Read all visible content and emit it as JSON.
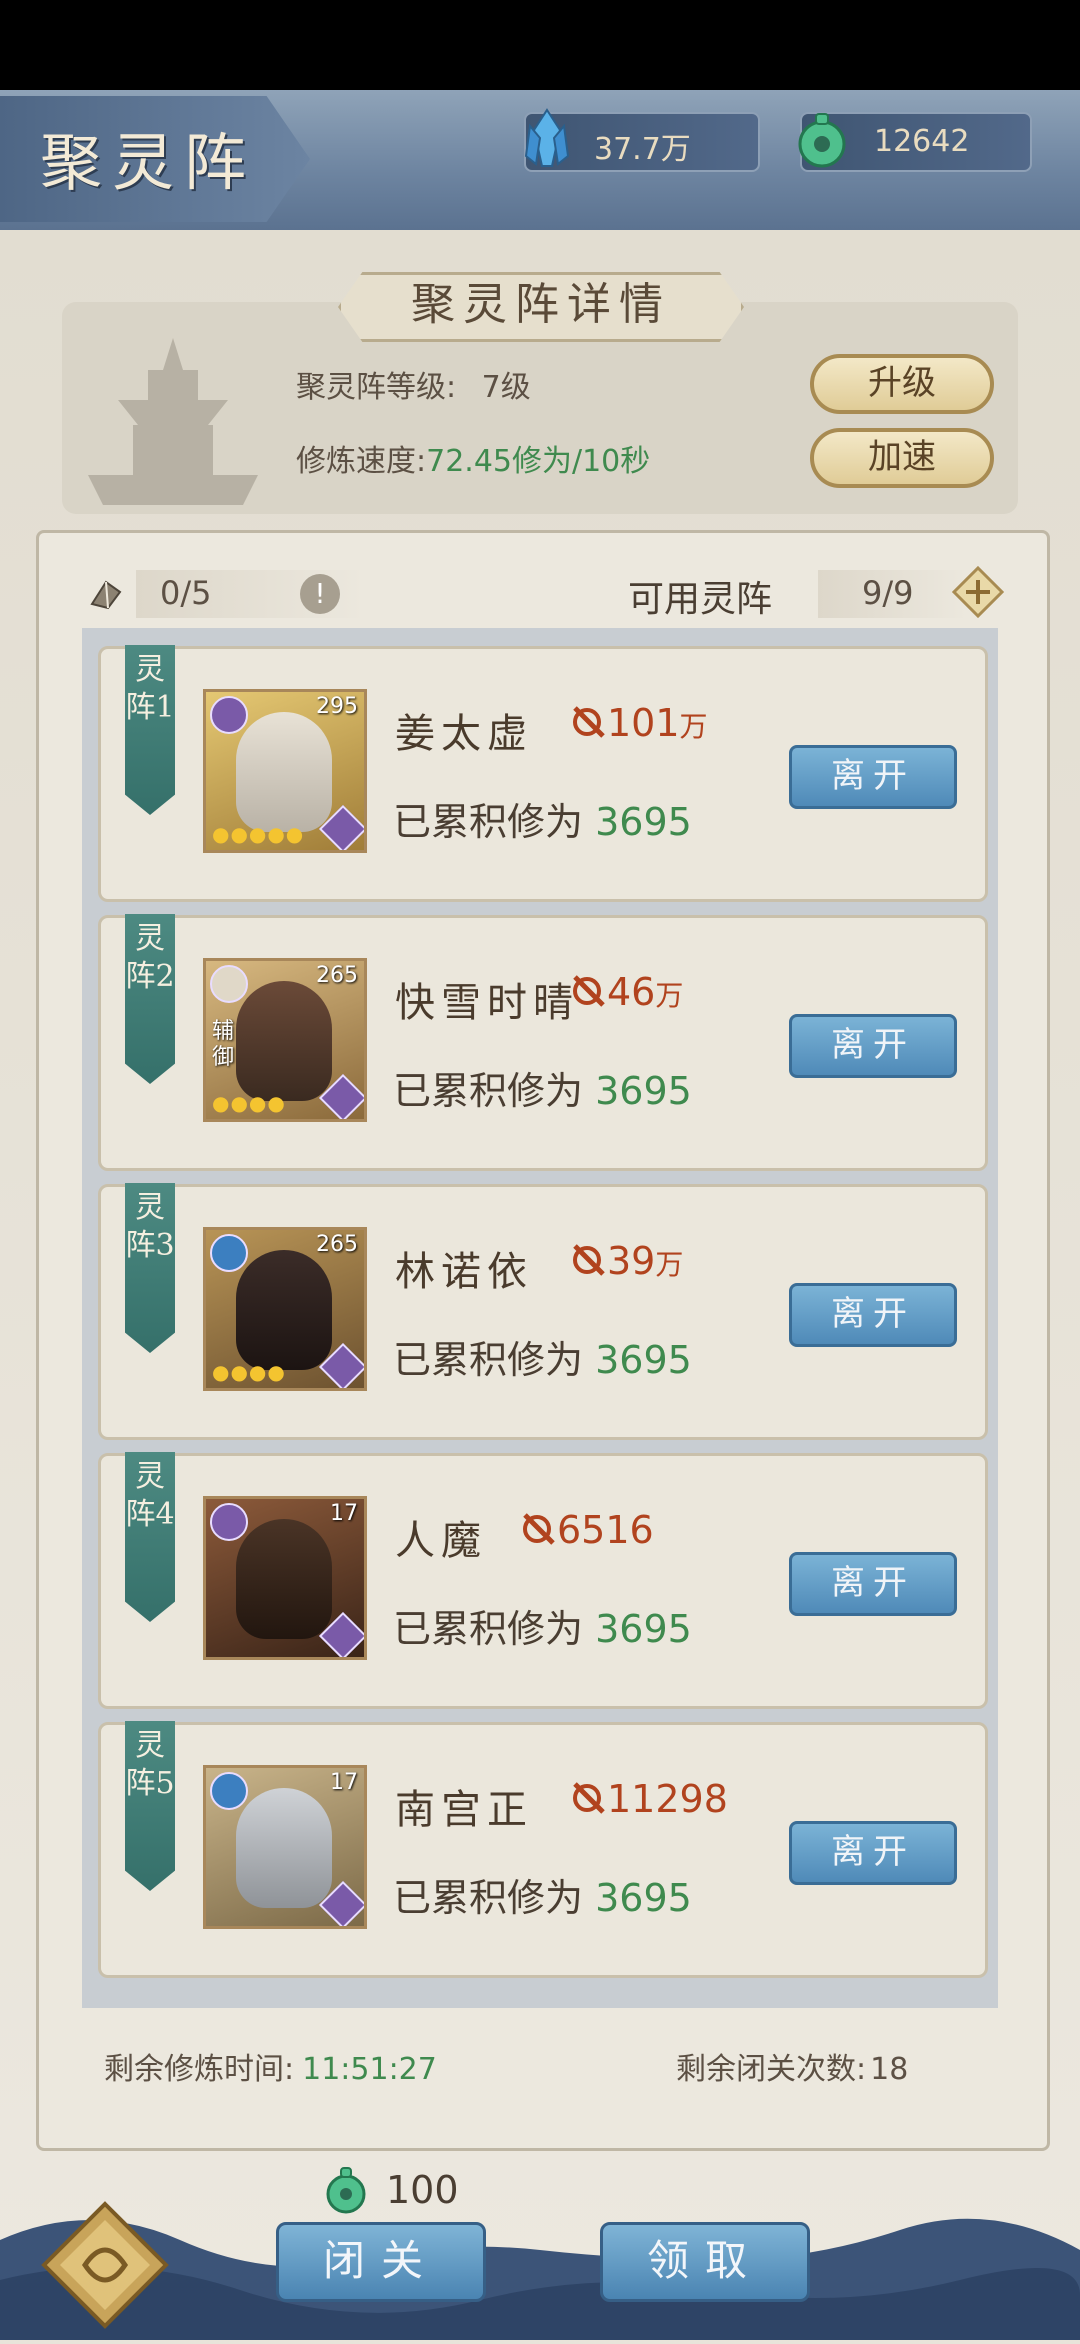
{
  "header": {
    "title": "聚灵阵",
    "spirit_stones": "37.7万",
    "jade": "12642"
  },
  "detail": {
    "section_title": "聚灵阵详情",
    "level_label": "聚灵阵等级:",
    "level_value": "7级",
    "speed_label": "修炼速度:",
    "speed_value": "72.45修为/10秒",
    "upgrade_label": "升级",
    "speedup_label": "加速"
  },
  "array_bar": {
    "occupied": "0/5",
    "available_label": "可用灵阵",
    "available_value": "9/9"
  },
  "slots": [
    {
      "tag": "灵阵1",
      "level": "295",
      "name": "姜太虚",
      "power": "101",
      "power_unit": "万",
      "accum_label": "已累积修为",
      "accum_value": "3695",
      "leave": "离开",
      "stars": "●●●●●"
    },
    {
      "tag": "灵阵2",
      "level": "265",
      "name": "快雪时晴",
      "power": "46",
      "power_unit": "万",
      "accum_label": "已累积修为",
      "accum_value": "3695",
      "leave": "离开",
      "role": "辅御",
      "stars": "●●●●"
    },
    {
      "tag": "灵阵3",
      "level": "265",
      "name": "林诺依",
      "power": "39",
      "power_unit": "万",
      "accum_label": "已累积修为",
      "accum_value": "3695",
      "leave": "离开",
      "stars": "●●●●"
    },
    {
      "tag": "灵阵4",
      "level": "17",
      "name": "人魔",
      "power": "6516",
      "power_unit": "",
      "accum_label": "已累积修为",
      "accum_value": "3695",
      "leave": "离开",
      "stars": ""
    },
    {
      "tag": "灵阵5",
      "level": "17",
      "name": "南宫正",
      "power": "11298",
      "power_unit": "",
      "accum_label": "已累积修为",
      "accum_value": "3695",
      "leave": "离开",
      "stars": ""
    }
  ],
  "footer": {
    "time_label": "剩余修炼时间:",
    "time_value": "11:51:27",
    "count_label": "剩余闭关次数:",
    "count_value": "18",
    "cost": "100",
    "seclusion_label": "闭关",
    "claim_label": "领取"
  },
  "colors": {
    "accent_green": "#3f8a4e",
    "power_red": "#b1431e",
    "slot_teal": "#35706a"
  }
}
